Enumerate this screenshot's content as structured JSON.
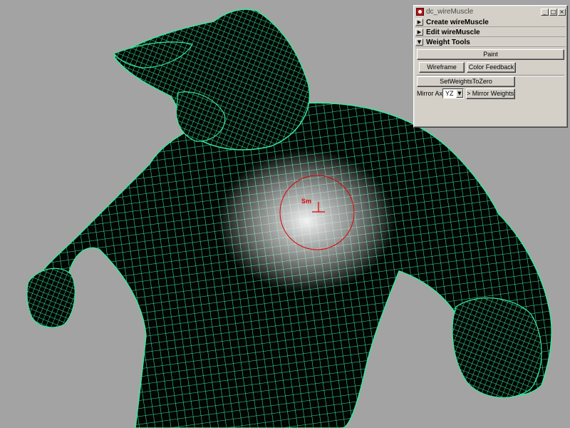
{
  "window": {
    "title": "dc_wireMuscle",
    "min_glyph": "_",
    "max_glyph": "□",
    "close_glyph": "×"
  },
  "frames": [
    {
      "label": "Create wireMuscle",
      "collapsed": true,
      "arrow": "▶"
    },
    {
      "label": "Edit wireMuscle",
      "collapsed": true,
      "arrow": "▶"
    },
    {
      "label": "Weight Tools",
      "collapsed": false,
      "arrow": "▼"
    }
  ],
  "buttons": {
    "paint": "Paint",
    "wireframe": "Wireframe",
    "color_feedback": "Color Feedback",
    "set_weights_to_zero": "SetWeightsToZero",
    "mirror_weights": "> Mirror Weights <"
  },
  "mirror_axis": {
    "label": "Mirror Axis",
    "value": "YZ"
  },
  "brush": {
    "label": "Sm",
    "color": "#e00000"
  },
  "colors": {
    "wire": "#39e69a",
    "viewport_bg": "#a3a3a3",
    "panel_bg": "#d4d0c8"
  }
}
